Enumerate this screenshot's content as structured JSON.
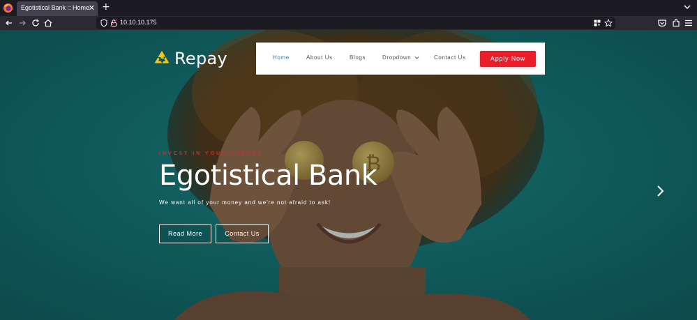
{
  "browser": {
    "tab_title": "Egotistical Bank :: Home",
    "tab_close_glyph": "✕",
    "new_tab_glyph": "+",
    "url": "10.10.10.175"
  },
  "site": {
    "brand": {
      "name": "Repay",
      "logo_icon": "recycle-icon",
      "logo_color": "#f5c518"
    },
    "menu": {
      "items": [
        {
          "label": "Home",
          "active": true
        },
        {
          "label": "About Us",
          "active": false
        },
        {
          "label": "Blogs",
          "active": false
        },
        {
          "label": "Dropdown",
          "active": false,
          "has_caret": true
        },
        {
          "label": "Contact Us",
          "active": false
        }
      ],
      "cta_label": "Apply Now",
      "cta_color": "#ec1d2b",
      "active_color": "#2a7fb5"
    },
    "hero": {
      "eyebrow": "INVEST IN YOUR FUTURE",
      "title": "Egotistical Bank",
      "subtitle": "We want all of your money and we're not afraid to ask!",
      "buttons": [
        {
          "label": "Read More"
        },
        {
          "label": "Contact Us"
        }
      ],
      "background_color": "#17706f"
    }
  }
}
